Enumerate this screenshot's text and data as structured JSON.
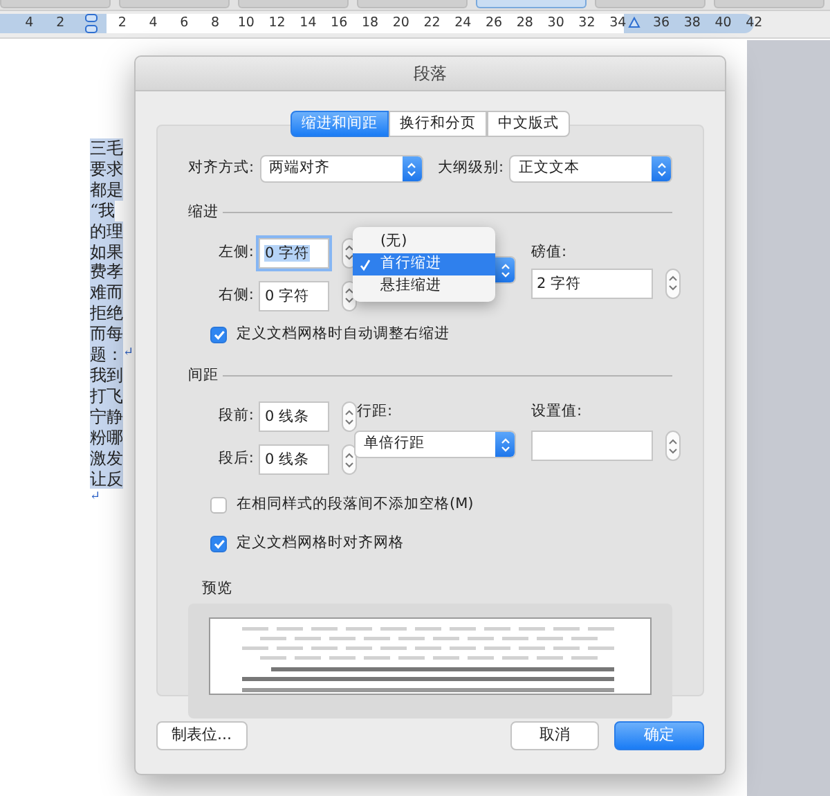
{
  "ruler": {
    "left_labels": [
      "4",
      "2"
    ],
    "labels": [
      "2",
      "4",
      "6",
      "8",
      "10",
      "12",
      "14",
      "16",
      "18",
      "20",
      "22",
      "24",
      "26",
      "28",
      "30",
      "32",
      "34"
    ],
    "right_labels": [
      "36",
      "38",
      "40",
      "42"
    ]
  },
  "document": {
    "lines": [
      {
        "text": "三毛"
      },
      {
        "text": "要求"
      },
      {
        "text": "都是"
      },
      {
        "text": "“我"
      },
      {
        "text": "的理"
      },
      {
        "text": "如果"
      },
      {
        "text": "费孝"
      },
      {
        "text": "难而"
      },
      {
        "text": "拒绝"
      },
      {
        "text": "而每"
      },
      {
        "text": "题：",
        "end_mark": "↵"
      },
      {
        "text": "我到"
      },
      {
        "text": "打飞"
      },
      {
        "text": "宁静"
      },
      {
        "text": "粉哪"
      },
      {
        "text": "激发"
      },
      {
        "text": "让反"
      },
      {
        "end_mark": "↵"
      }
    ]
  },
  "dialog": {
    "title": "段落",
    "tabs": [
      {
        "label": "缩进和间距",
        "selected": true
      },
      {
        "label": "换行和分页",
        "selected": false
      },
      {
        "label": "中文版式",
        "selected": false
      }
    ],
    "alignment": {
      "label": "对齐方式:",
      "value": "两端对齐"
    },
    "outline_level": {
      "label": "大纲级别:",
      "value": "正文文本"
    },
    "indent": {
      "heading": "缩进",
      "left": {
        "label": "左侧:",
        "value": "0 字符",
        "focused": true
      },
      "right": {
        "label": "右侧:",
        "value": "0 字符",
        "focused": false
      },
      "special_menu": [
        {
          "label": "(无)",
          "selected": false
        },
        {
          "label": "首行缩进",
          "selected": true
        },
        {
          "label": "悬挂缩进",
          "selected": false
        }
      ],
      "by": {
        "label": "磅值:",
        "value": "2 字符"
      },
      "auto_adjust": {
        "label": "定义文档网格时自动调整右缩进",
        "checked": true
      }
    },
    "spacing": {
      "heading": "间距",
      "before": {
        "label": "段前:",
        "value": "0 线条",
        "focused": false
      },
      "after": {
        "label": "段后:",
        "value": "0 线条",
        "focused": false
      },
      "line_spacing": {
        "label": "行距:",
        "value": "单倍行距"
      },
      "at": {
        "label": "设置值:"
      },
      "no_space_same_style": {
        "label": "在相同样式的段落间不添加空格(M)",
        "checked": false
      },
      "snap_to_grid": {
        "label": "定义文档网格时对齐网格",
        "checked": true
      }
    },
    "preview": {
      "heading": "预览"
    },
    "buttons": [
      {
        "label": "制表位...",
        "kind": "normal"
      },
      {
        "label": "取消",
        "kind": "normal"
      },
      {
        "label": "确定",
        "kind": "default"
      }
    ]
  }
}
